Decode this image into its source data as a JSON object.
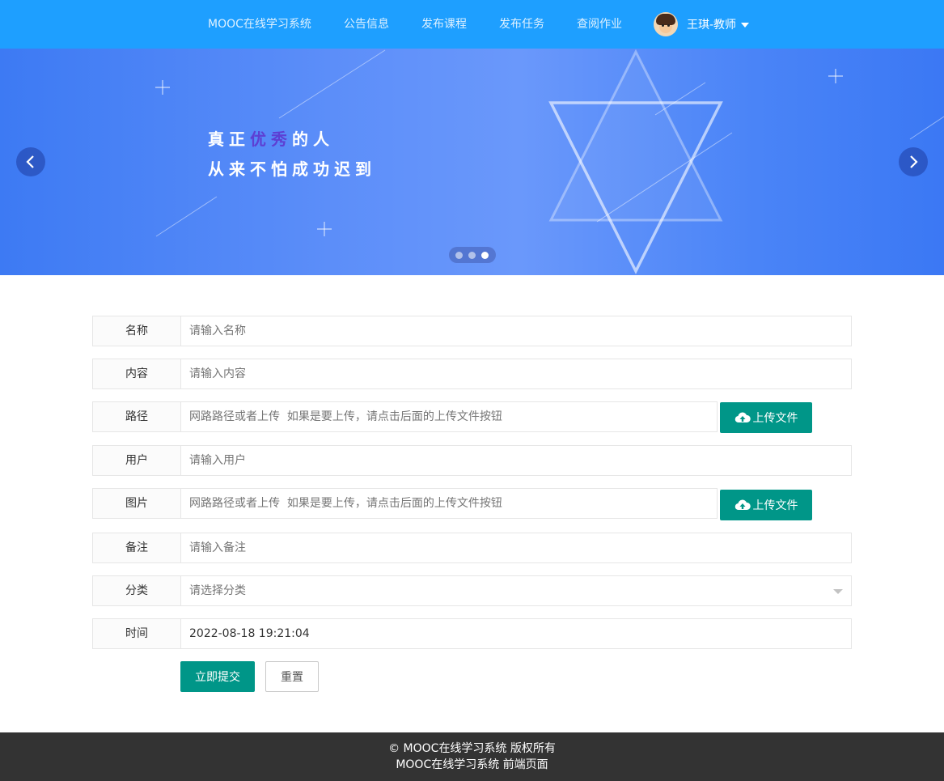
{
  "nav": {
    "items": [
      {
        "label": "MOOC在线学习系统"
      },
      {
        "label": "公告信息"
      },
      {
        "label": "发布课程"
      },
      {
        "label": "发布任务"
      },
      {
        "label": "查阅作业"
      }
    ],
    "user": {
      "name": "王琪-教师",
      "icon": "chevron-down-icon"
    },
    "background": "#1e9fff"
  },
  "banner": {
    "line1_part1": "真正",
    "line1_highlight": "优秀",
    "line1_part2": "的人",
    "line2": "从来不怕成功迟到",
    "slide_count": 3,
    "active_slide": 3
  },
  "form": {
    "fields": [
      {
        "label": "名称",
        "placeholder": "请输入名称",
        "value": ""
      },
      {
        "label": "内容",
        "placeholder": "请输入内容",
        "value": ""
      },
      {
        "label": "路径",
        "placeholder": "网路路径或者上传  如果是要上传，请点击后面的上传文件按钮",
        "value": ""
      },
      {
        "label": "用户",
        "placeholder": "请输入用户",
        "value": ""
      },
      {
        "label": "图片",
        "placeholder": "网路路径或者上传  如果是要上传，请点击后面的上传文件按钮",
        "value": ""
      },
      {
        "label": "备注",
        "placeholder": "请输入备注",
        "value": ""
      },
      {
        "label": "分类",
        "placeholder": "请选择分类",
        "value": ""
      },
      {
        "label": "时间",
        "placeholder": "",
        "value": "2022-08-18 19:21:04"
      }
    ],
    "upload_label": "上传文件",
    "submit_label": "立即提交",
    "reset_label": "重置",
    "accent": "#009688"
  },
  "footer": {
    "line1": "© MOOC在线学习系统 版权所有",
    "line2": "MOOC在线学习系统 前端页面",
    "background": "#333333"
  }
}
